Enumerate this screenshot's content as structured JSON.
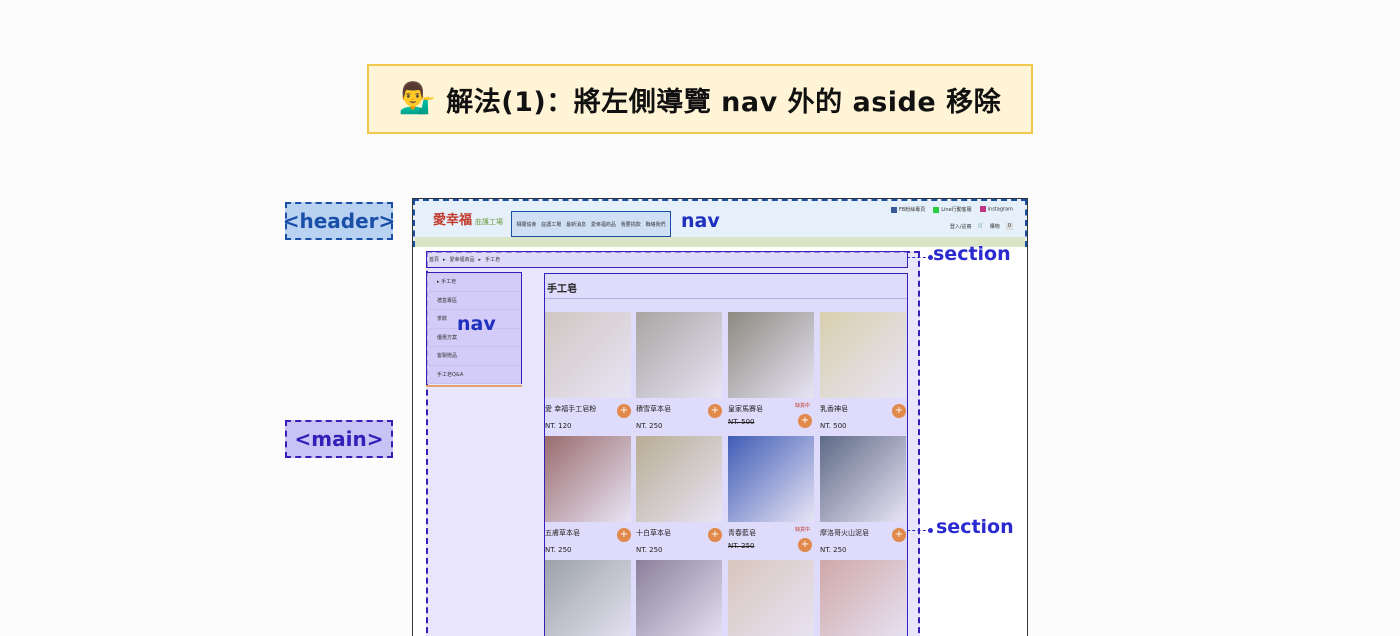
{
  "title": {
    "emoji": "💁‍♂️",
    "text": "解法(1)：將左側導覽 nav 外的 aside 移除"
  },
  "labels": {
    "header": "<header>",
    "main": "<main>",
    "nav_top": "nav",
    "nav_side": "nav",
    "section_top": "section",
    "section_mid": "section"
  },
  "site": {
    "logo": "愛幸福",
    "logo_sub": "庇護工場",
    "topnav": [
      "相關協會",
      "庇護工場",
      "最新消息",
      "愛幸福商品",
      "我要捐款",
      "聯絡我們"
    ],
    "social": [
      {
        "label": "FB粉絲專頁",
        "color": "#3b5998"
      },
      {
        "label": "Line行動客服",
        "color": "#2ecc40"
      },
      {
        "label": "instagram",
        "color": "#c13584"
      }
    ],
    "login": "登入/註冊",
    "cart": "購物",
    "cart_count": "0"
  },
  "breadcrumb": [
    "首頁",
    "▸",
    "愛幸福商品",
    "▸",
    "手工皂"
  ],
  "aside_items": [
    "▸ 手工皂",
    "禮盒專區",
    "茶飲",
    "優惠方案",
    "客製贈品",
    "手工皂Q&A"
  ],
  "content_title": "手工皂",
  "products": [
    {
      "name": "愛 幸福手工皂粉",
      "price": "NT. 120",
      "strike": false,
      "stock": "",
      "color": "#cfc7c2"
    },
    {
      "name": "積雪草本皂",
      "price": "NT. 250",
      "strike": false,
      "stock": "",
      "color": "#a9a4a2"
    },
    {
      "name": "皇家馬賽皂",
      "price": "NT. 500",
      "strike": true,
      "stock": "缺貨中",
      "color": "#8c8a80"
    },
    {
      "name": "乳香神皂",
      "price": "NT. 500",
      "strike": false,
      "stock": "",
      "color": "#d8cfae"
    },
    {
      "name": "五膚草本皂",
      "price": "NT. 250",
      "strike": false,
      "stock": "",
      "color": "#9a6d6e"
    },
    {
      "name": "十白草本皂",
      "price": "NT. 250",
      "strike": false,
      "stock": "",
      "color": "#b8ad94"
    },
    {
      "name": "青春藍皂",
      "price": "NT. 250",
      "strike": true,
      "stock": "缺貨中",
      "color": "#3f5cb5"
    },
    {
      "name": "摩洛哥火山泥皂",
      "price": "NT. 250",
      "strike": false,
      "stock": "",
      "color": "#5e6a86"
    },
    {
      "name": "",
      "price": "",
      "strike": false,
      "stock": "",
      "color": "#9ca3a9"
    },
    {
      "name": "",
      "price": "",
      "strike": false,
      "stock": "",
      "color": "#8b809c"
    },
    {
      "name": "",
      "price": "",
      "strike": false,
      "stock": "",
      "color": "#d8c6bd"
    },
    {
      "name": "",
      "price": "",
      "strike": false,
      "stock": "",
      "color": "#cfa8a8"
    }
  ]
}
